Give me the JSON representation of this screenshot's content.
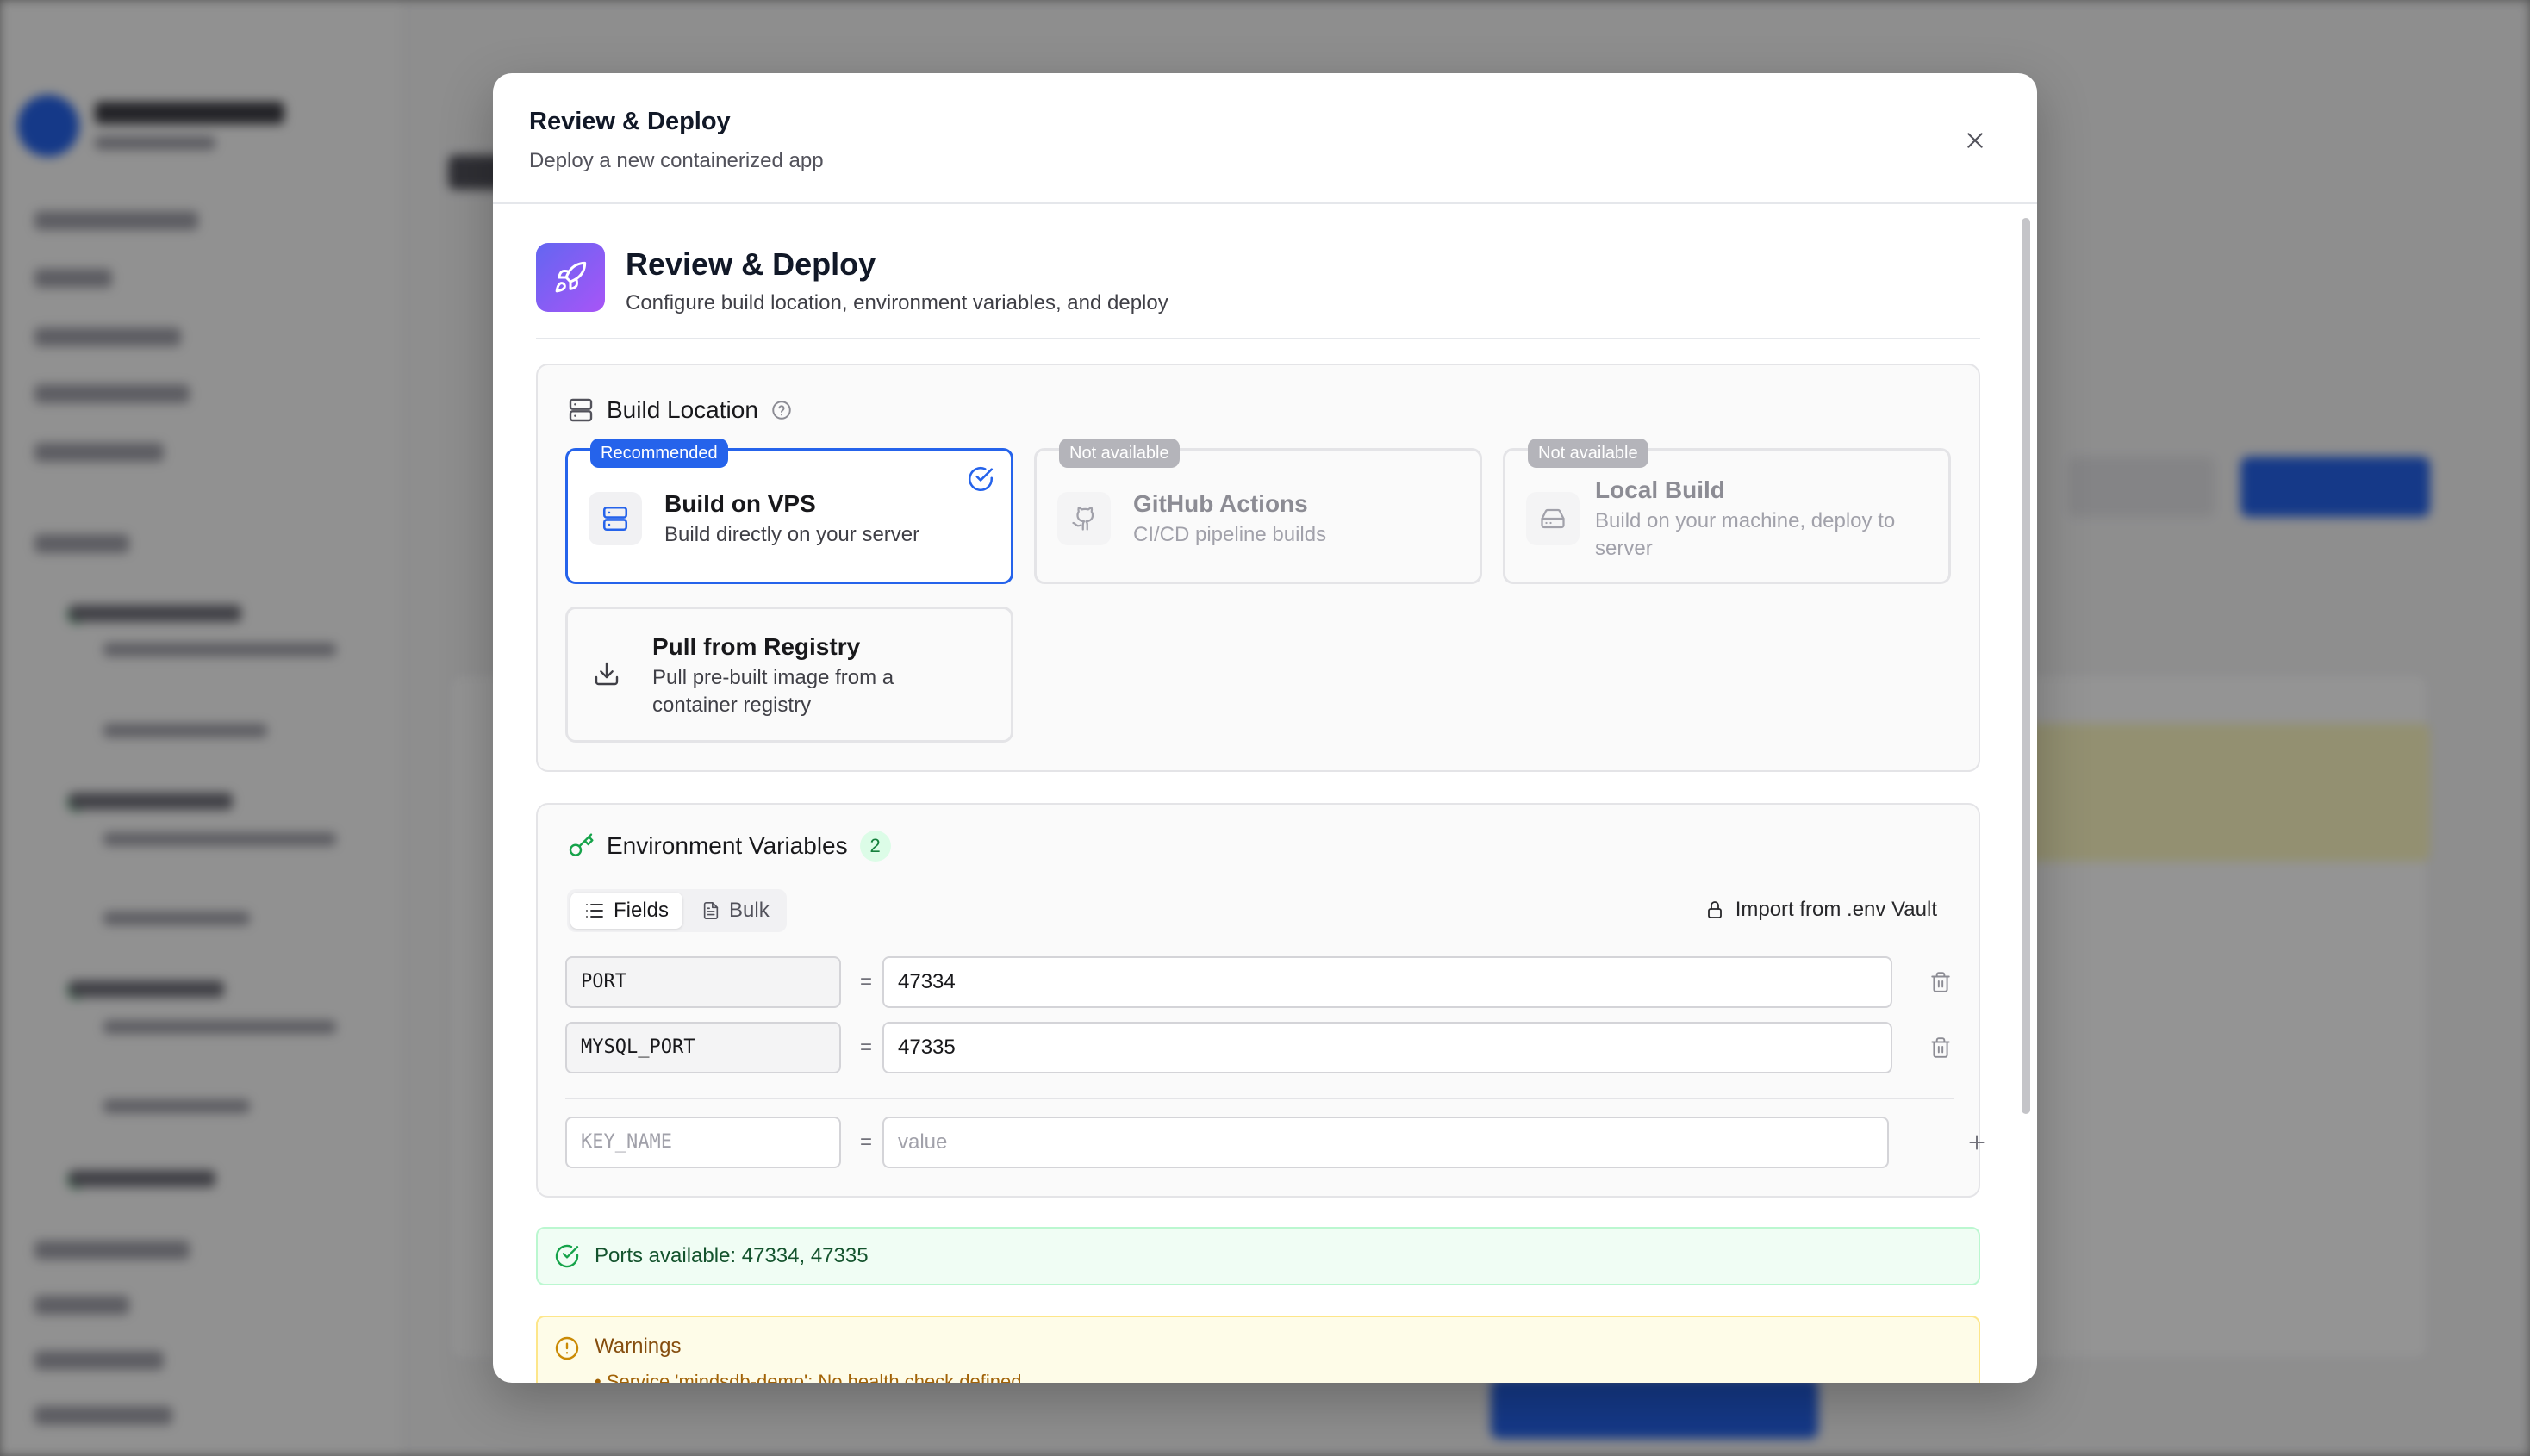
{
  "dialog": {
    "title": "Review & Deploy",
    "subtitle": "Deploy a new containerized app"
  },
  "hero": {
    "title": "Review & Deploy",
    "subtitle": "Configure build location, environment variables, and deploy"
  },
  "build_location": {
    "title": "Build Location",
    "options": [
      {
        "title": "Build on VPS",
        "description": "Build directly on your server",
        "badge": "Recommended",
        "selected": true,
        "available": true
      },
      {
        "title": "GitHub Actions",
        "description": "CI/CD pipeline builds",
        "badge": "Not available",
        "selected": false,
        "available": false
      },
      {
        "title": "Local Build",
        "description": "Build on your machine, deploy to server",
        "badge": "Not available",
        "selected": false,
        "available": false
      },
      {
        "title": "Pull from Registry",
        "description": "Pull pre-built image from a container registry",
        "badge": "",
        "selected": false,
        "available": true
      }
    ]
  },
  "env": {
    "title": "Environment Variables",
    "count": "2",
    "tabs": [
      {
        "label": "Fields",
        "active": true
      },
      {
        "label": "Bulk",
        "active": false
      }
    ],
    "import_label": "Import from .env Vault",
    "separator": "=",
    "rows": [
      {
        "key": "PORT",
        "value": "47334"
      },
      {
        "key": "MYSQL_PORT",
        "value": "47335"
      }
    ],
    "new_row": {
      "key_placeholder": "KEY_NAME",
      "value_placeholder": "value"
    }
  },
  "ports_banner": {
    "text": "Ports available: 47334, 47335"
  },
  "warnings": {
    "title": "Warnings",
    "items": [
      "• Service 'mindsdb-demo': No health check defined"
    ]
  },
  "colors": {
    "accent": "#2563eb",
    "success": "#16a34a",
    "warning": "#ca8a04"
  }
}
